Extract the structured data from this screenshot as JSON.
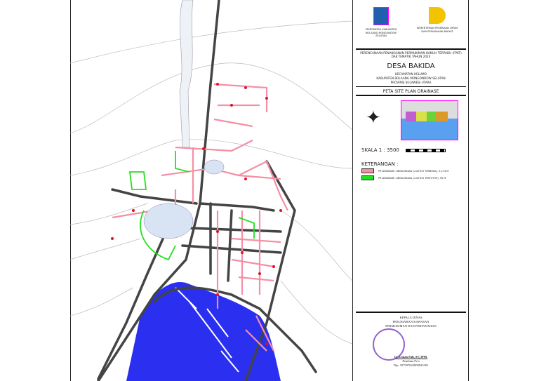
{
  "logos": {
    "left_caption": "PEMERINTAH KABUPATEN BOLAANG MONGONDOW SELATAN",
    "right_caption": "KEMENTERIAN PEKERJAAN UMUM DAN PERUMAHAN RAKYAT"
  },
  "title": {
    "program": "PERENCANAAN PENANGANAN PERMUKIMAN KUMUH TERPADU (FPKT) DAK TEMATIK TAHUN 2024",
    "village": "DESA BAKIDA",
    "district": "KECAMATAN HELUMO",
    "regency": "KABUPATEN BOLAANG MONGONDOW SELATAN",
    "province": "PROVINSI SULAWESI UTARA",
    "map_title": "PETA SITE PLAN DRAINASE"
  },
  "scale": {
    "label": "SKALA 1 : 3500"
  },
  "legend": {
    "heading": "KETERANGAN :",
    "items": [
      {
        "label": "PR DRAINASE LINGKUNGAN (U-DITCH TERBUKA), 3.274 M",
        "color": "#f58fa5"
      },
      {
        "label": "PR DRAINASE LINGKUNGAN (U-DITCH TERTUTUP), 55 M",
        "color": "#22e022"
      }
    ]
  },
  "signature": {
    "position": "KEPALA DINAS",
    "office_1": "PERUMAHAN KAWASAN",
    "office_2": "PERMUKIMAN DAN PERTANAHAN",
    "name": "Ir. Arman Pali, ST, IPM.",
    "rank": "Pembina IV.a",
    "nip": "Nip. 197507022009021001"
  },
  "colors": {
    "sea": "#2a2ff0",
    "road": "#444444",
    "drain_open": "#f58fa5",
    "drain_closed": "#22e022",
    "arrow": "#e0102a"
  }
}
